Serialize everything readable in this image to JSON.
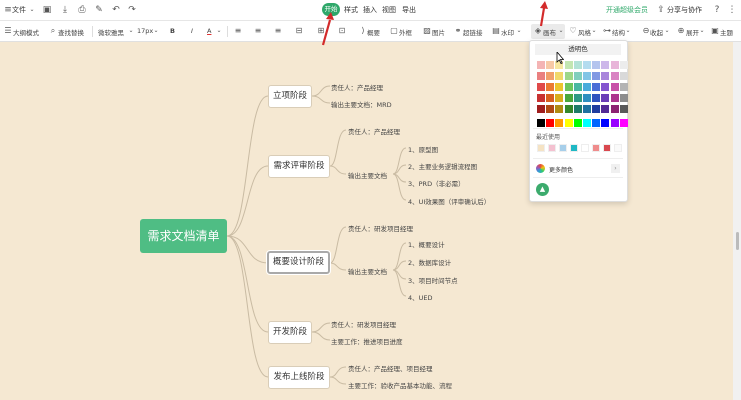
{
  "menubar": {
    "file_label": "文件",
    "tabs": [
      "样式",
      "插入",
      "视图",
      "导出"
    ],
    "active_tab": "开始",
    "upgrade_label": "开通超级会员",
    "share_label": "分享与协作"
  },
  "toolbar": {
    "outline_mode": "大纲模式",
    "find_replace": "查找替换",
    "font_family": "微软雅黑",
    "font_size": "17px",
    "bold": "B",
    "italic": "I",
    "font_color": "A",
    "summary": "概要",
    "border": "外框",
    "image": "图片",
    "hyperlink": "超链接",
    "watermark": "水印",
    "background": "画布",
    "style": "风格",
    "structure": "结构",
    "collapse": "收起",
    "expand": "展开",
    "theme": "主题"
  },
  "color_popup": {
    "fill_label": "透明色",
    "recent_label": "最近使用",
    "more_label": "更多颜色",
    "grid": [
      [
        "#f4b4b4",
        "#f7c9a6",
        "#f7e7a0",
        "#c3e6b1",
        "#b3e2d6",
        "#b3dcef",
        "#b3c4ee",
        "#cdb7ea",
        "#e8b5d9",
        "#ececec"
      ],
      [
        "#ea8080",
        "#f1a06b",
        "#f1d86a",
        "#9dd789",
        "#80cfbd",
        "#80c5e6",
        "#8099e3",
        "#a985dc",
        "#d983c3",
        "#d9d9d9"
      ],
      [
        "#e04a4a",
        "#eb7a32",
        "#ecc52f",
        "#6ec65e",
        "#4ab8a0",
        "#4aabdb",
        "#4a6ed7",
        "#8455cf",
        "#c851a8",
        "#b3b3b3"
      ],
      [
        "#c83232",
        "#d86020",
        "#d8ae1e",
        "#4aa83c",
        "#2f9a83",
        "#2f8fc0",
        "#2f53bf",
        "#6a3db7",
        "#ad358e",
        "#8c8c8c"
      ],
      [
        "#a01e1e",
        "#b04a14",
        "#b08c12",
        "#35882a",
        "#1f7c68",
        "#1f72a0",
        "#1f3d9f",
        "#532a96",
        "#8c2272",
        "#595959"
      ],
      [
        "#000000",
        "#ff0000",
        "#ff9900",
        "#ffff00",
        "#00ff00",
        "#00ffff",
        "#0066ff",
        "#0000ff",
        "#9900ff",
        "#ff00ff"
      ]
    ],
    "recent": [
      "#f5e3c4",
      "#f4c1d0",
      "#a7cfea",
      "#1fb8c4",
      "#ffffff",
      "#ef8c8c",
      "#d9484f",
      "#fafafa"
    ]
  },
  "mindmap": {
    "root": "需求文档清单",
    "branches": [
      {
        "label": "立项阶段",
        "items": [
          "责任人：产品经理",
          "输出主要文档：MRD"
        ]
      },
      {
        "label": "需求评审阶段",
        "items": [
          "责任人：产品经理",
          "输出主要文档"
        ],
        "sub": [
          "1、原型图",
          "2、主要业务逻辑流程图",
          "3、PRD（非必需）",
          "4、UI效果图（评审确认后）"
        ]
      },
      {
        "label": "概要设计阶段",
        "items": [
          "责任人：研发项目经理",
          "输出主要文档"
        ],
        "sub": [
          "1、概要设计",
          "2、数据库设计",
          "3、项目时间节点",
          "4、UED"
        ]
      },
      {
        "label": "开发阶段",
        "items": [
          "责任人：研发项目经理",
          "主要工作：推进项目进度"
        ]
      },
      {
        "label": "发布上线阶段",
        "items": [
          "责任人：产品经理、项目经理",
          "主要工作：验收产品基本功能、流程"
        ]
      }
    ]
  },
  "colors": {
    "accent": "#2fa86a",
    "canvas": "#f5e8d2",
    "root": "#4fbd84",
    "annotation": "#d32b2b"
  }
}
